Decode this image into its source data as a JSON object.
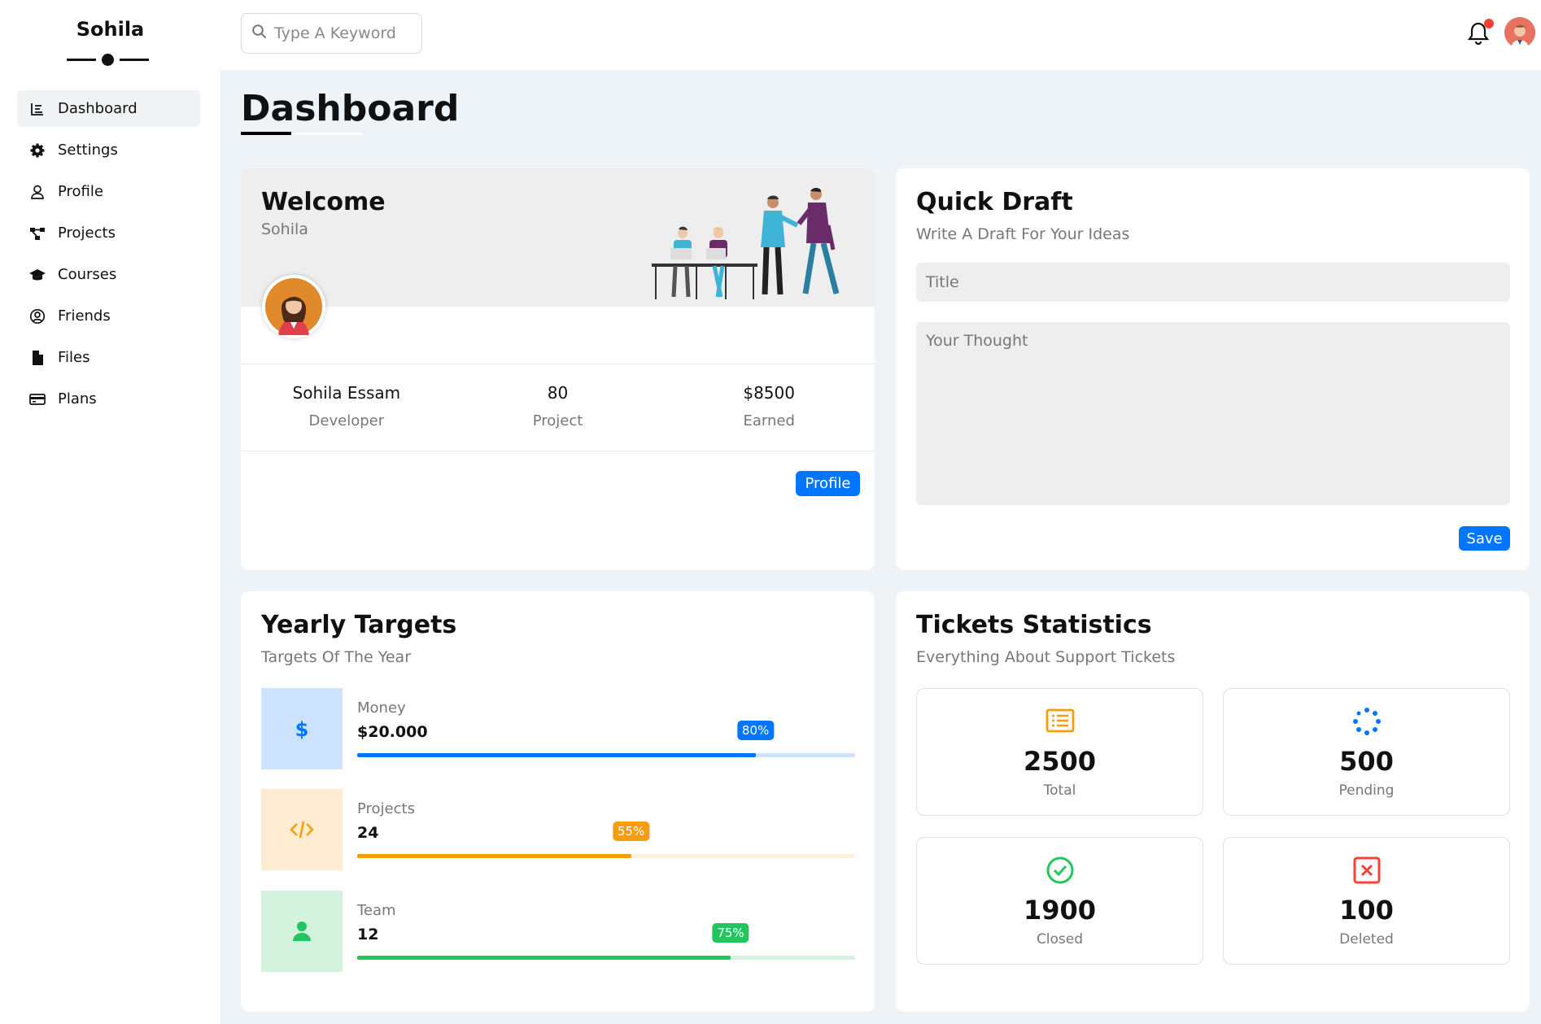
{
  "sidebar": {
    "brand": "Sohila",
    "items": [
      {
        "label": "Dashboard",
        "icon": "chart-icon",
        "active": true
      },
      {
        "label": "Settings",
        "icon": "gear-icon"
      },
      {
        "label": "Profile",
        "icon": "user-icon"
      },
      {
        "label": "Projects",
        "icon": "diagram-icon"
      },
      {
        "label": "Courses",
        "icon": "graduation-cap-icon"
      },
      {
        "label": "Friends",
        "icon": "user-circle-icon"
      },
      {
        "label": "Files",
        "icon": "file-icon"
      },
      {
        "label": "Plans",
        "icon": "credit-card-icon"
      }
    ]
  },
  "topbar": {
    "search_placeholder": "Type A Keyword",
    "notification_dot_color": "#f44336"
  },
  "page": {
    "title": "Dashboard"
  },
  "welcome": {
    "title": "Welcome",
    "name": "Sohila",
    "stats": [
      {
        "value": "Sohila Essam",
        "label": "Developer"
      },
      {
        "value": "80",
        "label": "Project"
      },
      {
        "value": "$8500",
        "label": "Earned"
      }
    ],
    "button": "Profile"
  },
  "draft": {
    "title": "Quick Draft",
    "subtitle": "Write A Draft For Your Ideas",
    "title_placeholder": "Title",
    "thought_placeholder": "Your Thought",
    "button": "Save"
  },
  "targets": {
    "title": "Yearly Targets",
    "subtitle": "Targets Of The Year",
    "items": [
      {
        "label": "Money",
        "value": "$20.000",
        "percent": 80,
        "percent_label": "80%",
        "icon": "dollar-icon",
        "color": "#0075ff",
        "bg": "#cce2ff",
        "track": "#cce2ff"
      },
      {
        "label": "Projects",
        "value": "24",
        "percent": 55,
        "percent_label": "55%",
        "icon": "code-icon",
        "color": "#f59e0b",
        "bg": "#fdecd2",
        "track": "#fdf1da"
      },
      {
        "label": "Team",
        "value": "12",
        "percent": 75,
        "percent_label": "75%",
        "icon": "user-icon",
        "color": "#22c55e",
        "bg": "#d3f3df",
        "track": "#d8f2e2"
      }
    ]
  },
  "tickets": {
    "title": "Tickets Statistics",
    "subtitle": "Everything About Support Tickets",
    "items": [
      {
        "value": "2500",
        "label": "Total",
        "icon": "list-icon",
        "color": "#f59e0b"
      },
      {
        "value": "500",
        "label": "Pending",
        "icon": "spinner-icon",
        "color": "#0075ff"
      },
      {
        "value": "1900",
        "label": "Closed",
        "icon": "check-circle-icon",
        "color": "#22c55e"
      },
      {
        "value": "100",
        "label": "Deleted",
        "icon": "x-square-icon",
        "color": "#f44336"
      }
    ]
  },
  "colors": {
    "accent": "#0075ff",
    "background": "#eef3f8"
  }
}
